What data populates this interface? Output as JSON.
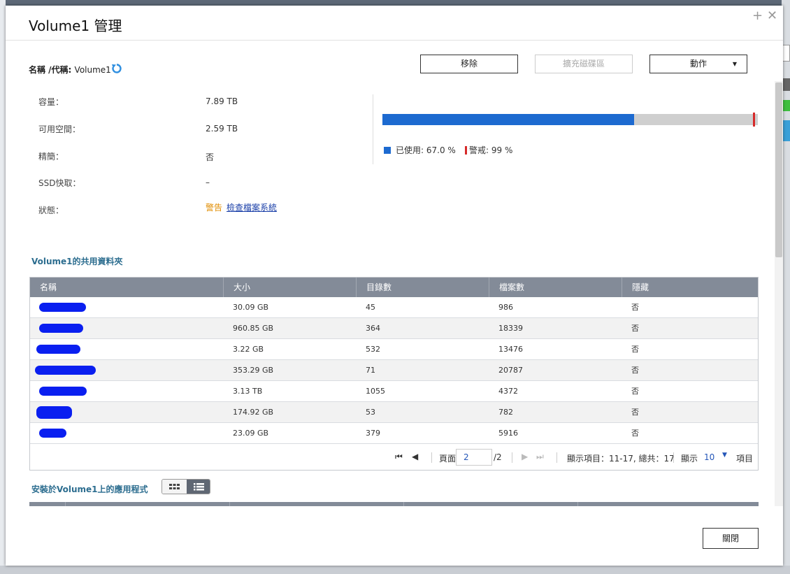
{
  "dialog": {
    "title": "Volume1 管理",
    "name_label": "名稱 /代稱: ",
    "name_value": "Volume1",
    "buttons": {
      "remove": "移除",
      "expand": "擴充磁碟區",
      "action": "動作",
      "close": "關閉"
    }
  },
  "info": {
    "capacity_label": "容量：",
    "capacity_value": "7.89 TB",
    "free_label": "可用空間：",
    "free_value": "2.59 TB",
    "thin_label": "精簡：",
    "thin_value": "否",
    "ssd_label": "SSD快取：",
    "ssd_value": "–",
    "status_label": "狀態：",
    "status_value": "警告",
    "check_fs_link": "檢查檔案系統"
  },
  "usage": {
    "used_percent": 67.0,
    "warn_percent": 99,
    "used_legend": "已使用: 67.0 %",
    "warn_legend": "警戒:  99 %",
    "colors": {
      "used": "#1d6ad0",
      "warn": "#d62a2a",
      "remaining": "#cfcfcf"
    }
  },
  "shared_folders": {
    "title": "Volume1的共用資料夾",
    "columns": [
      "名稱",
      "大小",
      "目錄數",
      "檔案數",
      "隱藏"
    ],
    "rows": [
      {
        "size": "30.09 GB",
        "dirs": "45",
        "files": "986",
        "hidden": "否"
      },
      {
        "size": "960.85 GB",
        "dirs": "364",
        "files": "18339",
        "hidden": "否"
      },
      {
        "size": "3.22 GB",
        "dirs": "532",
        "files": "13476",
        "hidden": "否"
      },
      {
        "size": "353.29 GB",
        "dirs": "71",
        "files": "20787",
        "hidden": "否"
      },
      {
        "size": "3.13 TB",
        "dirs": "1055",
        "files": "4372",
        "hidden": "否"
      },
      {
        "size": "174.92 GB",
        "dirs": "53",
        "files": "782",
        "hidden": "否"
      },
      {
        "size": "23.09 GB",
        "dirs": "379",
        "files": "5916",
        "hidden": "否"
      }
    ]
  },
  "pagination": {
    "page_label": "頁面",
    "page_value": "2",
    "page_total": "/2",
    "display_items": "顯示項目：11-17, 總共：17",
    "show_label": "顯示",
    "per_page": "10",
    "items_label": "項目"
  },
  "apps_section": {
    "title": "安裝於Volume1上的應用程式"
  },
  "icons": [
    "refresh-icon",
    "first-page-icon",
    "prev-page-icon",
    "next-page-icon",
    "last-page-icon",
    "grid-view-icon",
    "list-view-icon",
    "chevron-down-icon",
    "plus-icon",
    "close-icon"
  ]
}
